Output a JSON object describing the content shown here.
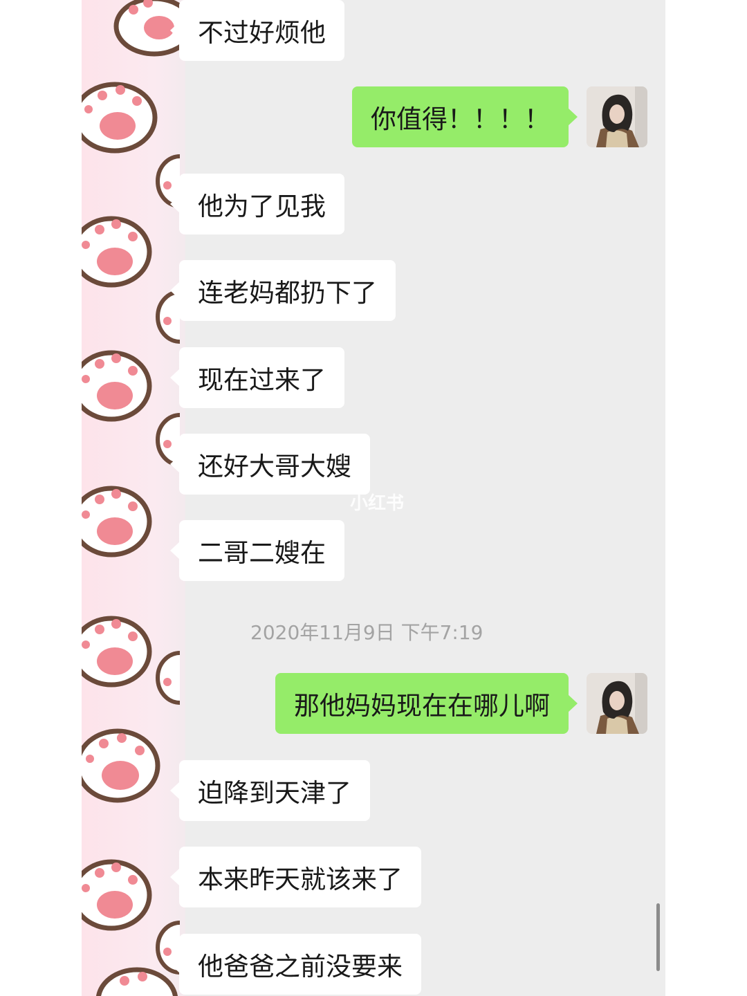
{
  "chat": {
    "messages": [
      {
        "side": "in",
        "text": "不过好烦他"
      },
      {
        "side": "out",
        "text": "你值得！！！！"
      },
      {
        "side": "in",
        "text": "他为了见我"
      },
      {
        "side": "in",
        "text": "连老妈都扔下了"
      },
      {
        "side": "in",
        "text": "现在过来了"
      },
      {
        "side": "in",
        "text": "还好大哥大嫂"
      },
      {
        "side": "in",
        "text": "二哥二嫂在"
      },
      {
        "side": "out",
        "text": "那他妈妈现在在哪儿啊"
      },
      {
        "side": "in",
        "text": "迫降到天津了"
      },
      {
        "side": "in",
        "text": "本来昨天就该来了"
      },
      {
        "side": "in",
        "text": "他爸爸之前没要来"
      }
    ],
    "timestamp": "2020年11月9日 下午7:19"
  },
  "watermark": "小红书",
  "colors": {
    "chat_background": "#ededed",
    "incoming_bubble": "#ffffff",
    "outgoing_bubble": "#95ec69",
    "wallpaper_pink": "#fde3ea",
    "paw_pad": "#f08a94",
    "paw_outline": "#6b4a3a"
  },
  "icons": {
    "wallpaper": "cat-paw-icon",
    "avatar": "user-avatar"
  }
}
